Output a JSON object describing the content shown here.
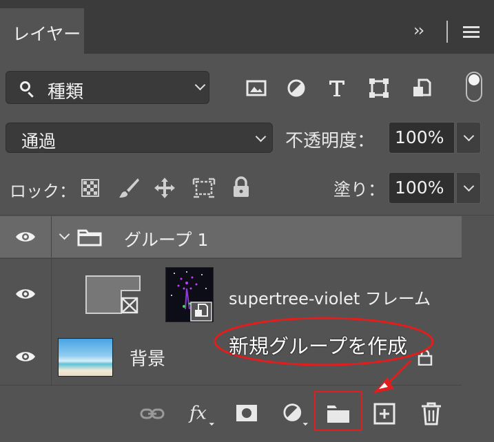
{
  "header": {
    "tab_label": "レイヤー",
    "expand_glyph": "››"
  },
  "filter": {
    "label": "種類"
  },
  "blend": {
    "mode": "通過"
  },
  "opacity": {
    "label": "不透明度：",
    "value": "100%"
  },
  "lock": {
    "label": "ロック："
  },
  "fill": {
    "label": "塗り：",
    "value": "100%"
  },
  "layers": {
    "group": {
      "name": "グループ 1"
    },
    "frame": {
      "name": "supertree-violet フレーム"
    },
    "background": {
      "name": "背景"
    }
  },
  "annotation": {
    "text": "新規グループを作成",
    "color": "#e21d1d"
  },
  "icons": {
    "filter": [
      "image-icon",
      "adjustment-icon",
      "text-type-icon",
      "shape-icon",
      "smart-object-icon"
    ],
    "lock": [
      "lock-pixels-icon",
      "lock-brush-icon",
      "lock-position-icon",
      "lock-artboard-icon",
      "lock-all-icon"
    ],
    "bottom": [
      "link-icon",
      "fx-icon",
      "mask-icon",
      "adjustment-layer-icon",
      "new-group-icon",
      "new-layer-icon",
      "trash-icon"
    ]
  },
  "colors": {
    "panel": "#535353",
    "header": "#3b3b3b",
    "group_row": "#696969",
    "highlight": "#e21d1d"
  }
}
